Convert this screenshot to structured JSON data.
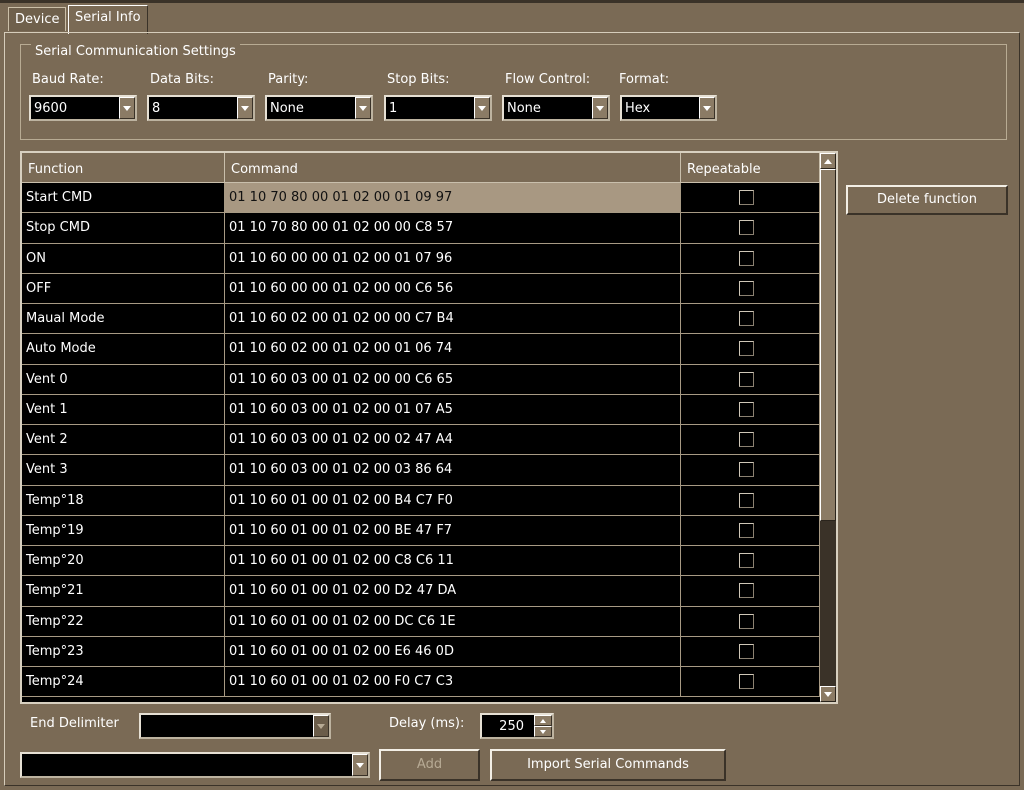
{
  "tabs": [
    {
      "label": "Device",
      "active": false
    },
    {
      "label": "Serial Info",
      "active": true
    }
  ],
  "serial_settings": {
    "legend": "Serial Communication Settings",
    "fields": [
      {
        "label": "Baud Rate:",
        "value": "9600"
      },
      {
        "label": "Data Bits:",
        "value": "8"
      },
      {
        "label": "Parity:",
        "value": "None"
      },
      {
        "label": "Stop Bits:",
        "value": "1"
      },
      {
        "label": "Flow Control:",
        "value": "None"
      },
      {
        "label": "Format:",
        "value": "Hex"
      }
    ]
  },
  "table": {
    "columns": [
      "Function",
      "Command",
      "Repeatable"
    ],
    "rows": [
      {
        "function": "Start CMD",
        "command": "01 10 70 80 00 01 02 00 01 09 97",
        "repeatable": false,
        "selected": true
      },
      {
        "function": "Stop CMD",
        "command": "01 10 70 80 00 01 02 00 00 C8 57",
        "repeatable": false
      },
      {
        "function": "ON",
        "command": "01 10 60 00 00 01 02 00 01 07 96",
        "repeatable": false
      },
      {
        "function": "OFF",
        "command": "01 10 60 00 00 01 02 00 00 C6 56",
        "repeatable": false
      },
      {
        "function": "Maual Mode",
        "command": "01 10 60 02 00 01 02 00 00 C7 B4",
        "repeatable": false
      },
      {
        "function": "Auto Mode",
        "command": "01 10 60 02 00 01 02 00 01 06 74",
        "repeatable": false
      },
      {
        "function": "Vent 0",
        "command": "01 10 60 03 00 01 02 00 00 C6 65",
        "repeatable": false
      },
      {
        "function": "Vent 1",
        "command": "01 10 60 03 00 01 02 00 01 07 A5",
        "repeatable": false
      },
      {
        "function": "Vent 2",
        "command": "01 10 60 03 00 01 02 00 02 47 A4",
        "repeatable": false
      },
      {
        "function": "Vent 3",
        "command": "01 10 60 03 00 01 02 00 03 86 64",
        "repeatable": false
      },
      {
        "function": "Temp°18",
        "command": "01 10 60 01 00 01 02 00 B4 C7 F0",
        "repeatable": false
      },
      {
        "function": "Temp°19",
        "command": "01 10 60 01 00 01 02 00 BE 47 F7",
        "repeatable": false
      },
      {
        "function": "Temp°20",
        "command": "01 10 60 01 00 01 02 00 C8 C6 11",
        "repeatable": false
      },
      {
        "function": "Temp°21",
        "command": "01 10 60 01 00 01 02 00 D2 47 DA",
        "repeatable": false
      },
      {
        "function": "Temp°22",
        "command": "01 10 60 01 00 01 02 00 DC C6 1E",
        "repeatable": false
      },
      {
        "function": "Temp°23",
        "command": "01 10 60 01 00 01 02 00 E6 46 0D",
        "repeatable": false
      },
      {
        "function": "Temp°24",
        "command": "01 10 60 01 00 01 02 00 F0 C7 C3",
        "repeatable": false
      }
    ]
  },
  "actions": {
    "delete_function": "Delete function",
    "add": "Add",
    "import": "Import Serial Commands"
  },
  "end_delimiter": {
    "label": "End Delimiter",
    "value": ""
  },
  "delay": {
    "label": "Delay (ms):",
    "value": "250"
  },
  "command_select": {
    "value": ""
  },
  "colors": {
    "background": "#7a6a55",
    "grid_bg": "#000000",
    "selected_row": "#a89882"
  },
  "icons": [
    "chevron-down-icon",
    "chevron-up-icon",
    "checkbox-icon"
  ]
}
